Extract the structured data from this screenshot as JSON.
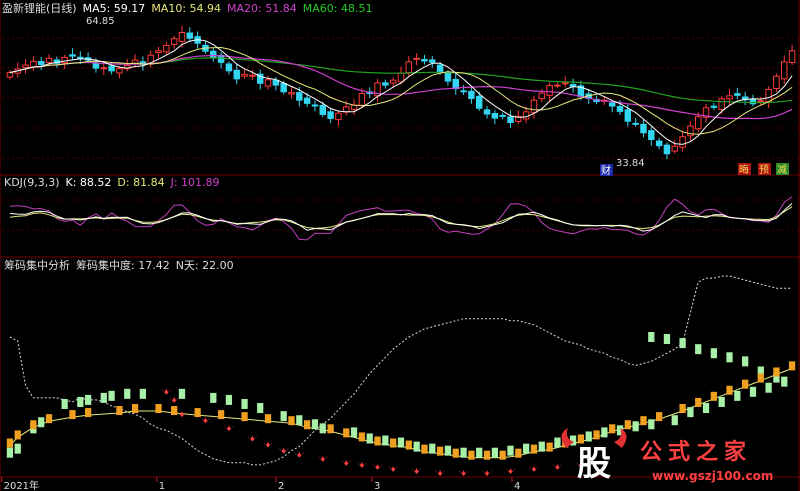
{
  "colors": {
    "bg": "#000000",
    "frame": "#6e0000",
    "grid": "#5a0000",
    "up": "#ff3a3a",
    "down": "#33d6f0",
    "ma5": "#ffffff",
    "ma10": "#e8e87a",
    "ma20": "#d040d0",
    "ma60": "#22a022",
    "k": "#ffffff",
    "d": "#e8e87a",
    "j": "#c040c0",
    "green_bar": "#a8f0a8",
    "orange_bar": "#f0a020",
    "red_mark": "#ff4040"
  },
  "price_panel": {
    "title": "盈新锂能(日线)",
    "ma5_label": "MA5: 59.17",
    "ma10_label": "MA10: 54.94",
    "ma20_label": "MA20: 51.84",
    "ma60_label": "MA60: 48.51",
    "high_label": "64.85",
    "low_label": "33.84",
    "flag_cai": "财",
    "flag_hui": "晦",
    "flag_yu": "预",
    "flag_jian": "减"
  },
  "kdj_panel": {
    "title": "KDJ(9,3,3)",
    "k_label": "K: 88.52",
    "d_label": "D: 81.84",
    "j_label": "J: 101.89"
  },
  "chip_panel": {
    "title": "筹码集中分析",
    "conc_label": "筹码集中度: 17.42",
    "n_label": "N天: 22.00"
  },
  "x_axis": {
    "ticks": [
      {
        "label": "2021年",
        "pos": 0.002
      },
      {
        "label": "1",
        "pos": 0.196
      },
      {
        "label": "2",
        "pos": 0.345
      },
      {
        "label": "3",
        "pos": 0.465
      },
      {
        "label": "4",
        "pos": 0.64
      }
    ]
  },
  "watermark": {
    "big_char": "股",
    "text": "公式之家",
    "url": "www.gszj100.com"
  },
  "chart_data": [
    {
      "type": "candlestick",
      "title": "盈新锂能(日线)",
      "n_days": 101,
      "ylim": [
        32,
        67
      ],
      "close": [
        54.3,
        55.1,
        56.0,
        56.8,
        56.1,
        57.5,
        56.4,
        57.7,
        58.0,
        57.4,
        57.1,
        55.3,
        55.4,
        54.7,
        55.2,
        55.9,
        57.1,
        56.1,
        58.2,
        59.2,
        60.4,
        61.9,
        63.3,
        62.0,
        60.9,
        59.1,
        57.7,
        56.6,
        54.7,
        52.9,
        53.9,
        53.7,
        51.9,
        52.7,
        51.5,
        50.0,
        49.8,
        48.1,
        47.4,
        46.8,
        44.9,
        44.0,
        45.2,
        46.6,
        47.0,
        49.6,
        49.6,
        52.0,
        51.5,
        52.6,
        54.2,
        56.7,
        57.5,
        56.9,
        56.6,
        54.4,
        52.4,
        50.7,
        50.1,
        48.5,
        46.3,
        45.0,
        44.1,
        44.6,
        43.1,
        44.5,
        45.5,
        48.1,
        49.7,
        51.4,
        51.5,
        52.0,
        51.2,
        48.9,
        48.5,
        47.8,
        48.1,
        46.8,
        45.6,
        43.4,
        42.7,
        40.8,
        39.3,
        37.9,
        36.1,
        37.8,
        39.9,
        42.3,
        44.4,
        46.4,
        46.5,
        48.4,
        49.1,
        49.2,
        48.2,
        47.3,
        48.0,
        50.5,
        53.5,
        56.7,
        59.2
      ],
      "ma5_last": 59.17,
      "ma10_last": 54.94,
      "ma20_last": 51.84,
      "ma60_last": 48.51,
      "high": 64.85,
      "low": 33.84
    },
    {
      "type": "line",
      "title": "KDJ(9,3,3)",
      "ylim": [
        -10,
        115
      ],
      "series": [
        {
          "name": "K",
          "values": [
            68.3,
            67.2,
            66.6,
            71.5,
            72.8,
            71.0,
            63.3,
            57.4,
            57.3,
            55.5,
            58.3,
            61.6,
            58.6,
            61.1,
            60.7,
            60.9,
            54.1,
            48.5,
            47.8,
            50.1,
            56.3,
            62.4,
            69.4,
            69.5,
            64.6,
            58.6,
            53.1,
            54.5,
            51.6,
            47.1,
            48.6,
            47.7,
            46.7,
            52.2,
            57.6,
            56.6,
            54.0,
            45.6,
            35.2,
            38.6,
            37.9,
            35.9,
            43.5,
            51.5,
            54.4,
            58.8,
            62.6,
            68.1,
            67.8,
            67.7,
            65.6,
            68.3,
            65.9,
            66.2,
            64.3,
            56.3,
            48.8,
            47.0,
            46.2,
            43.5,
            38.4,
            42.2,
            46.1,
            50.1,
            58.5,
            66.8,
            67.9,
            71.2,
            65.6,
            59.3,
            55.4,
            49.6,
            45.7,
            44.9,
            45.2,
            44.0,
            44.6,
            43.2,
            45.1,
            43.5,
            38.8,
            33.4,
            36.0,
            44.1,
            53.9,
            64.9,
            71.5,
            67.5,
            63.8,
            60.2,
            65.9,
            66.1,
            60.7,
            58.8,
            58.1,
            55.3,
            54.7,
            53.7,
            59.1,
            74.7,
            88.5
          ]
        },
        {
          "name": "D",
          "values": [
            61.1,
            62.9,
            63.8,
            68.5,
            69.6,
            65.8,
            60.5,
            57.0,
            57.9,
            57.6,
            58.7,
            59.6,
            58.0,
            58.4,
            59.4,
            59.0,
            54.6,
            51.3,
            50.8,
            52.4,
            56.2,
            61.8,
            66.9,
            66.2,
            62.6,
            58.3,
            55.3,
            53.9,
            51.1,
            48.5,
            49.1,
            50.6,
            51.4,
            53.4,
            56.1,
            55.6,
            51.4,
            45.6,
            40.5,
            38.9,
            39.9,
            41.4,
            45.9,
            51.3,
            55.3,
            58.6,
            63.3,
            65.8,
            66.4,
            66.1,
            66.4,
            65.2,
            65.2,
            64.6,
            61.7,
            57.5,
            51.6,
            47.2,
            45.1,
            43.2,
            42.3,
            44.5,
            48.4,
            54.1,
            60.7,
            64.9,
            66.5,
            66.0,
            62.5,
            58.5,
            53.9,
            49.8,
            46.0,
            44.0,
            43.8,
            44.0,
            44.8,
            44.7,
            44.2,
            41.5,
            39.6,
            38.6,
            40.3,
            45.4,
            53.8,
            61.1,
            63.2,
            62.6,
            61.6,
            63.3,
            64.0,
            63.1,
            61.3,
            58.9,
            58.0,
            57.2,
            56.8,
            56.3,
            61.9,
            72.1,
            81.8
          ]
        },
        {
          "name": "J",
          "values": [
            82.7,
            83.6,
            82.3,
            77.5,
            78.0,
            73.5,
            58.2,
            52.7,
            55.4,
            44.9,
            59.6,
            67.7,
            56.9,
            69.5,
            59.0,
            53.5,
            42.4,
            42.1,
            42.8,
            54.3,
            66.3,
            85.0,
            85.5,
            70.2,
            53.6,
            45.0,
            46.9,
            58.1,
            49.8,
            42.1,
            40.3,
            35.9,
            44.2,
            54.7,
            59.3,
            52.1,
            39.2,
            16.9,
            16.0,
            29.2,
            28.9,
            29.1,
            47.2,
            64.6,
            70.1,
            74.6,
            77.1,
            79.9,
            72.8,
            73.4,
            74.7,
            74.7,
            68.5,
            65.6,
            57.3,
            37.5,
            31.3,
            33.0,
            30.3,
            27.2,
            28.1,
            37.3,
            48.4,
            66.0,
            87.5,
            87.6,
            82.7,
            69.6,
            50.4,
            39.1,
            34.1,
            30.8,
            28.1,
            33.4,
            38.3,
            37.0,
            40.5,
            36.3,
            36.7,
            34.9,
            27.7,
            25.7,
            35.5,
            54.7,
            81.3,
            96.8,
            86.6,
            72.0,
            65.6,
            75.8,
            76.7,
            68.7,
            59.8,
            59.0,
            57.4,
            54.2,
            53.6,
            50.5,
            65.4,
            90.4,
            101.9
          ]
        }
      ],
      "last": {
        "K": 88.52,
        "D": 81.84,
        "J": 101.89
      }
    },
    {
      "type": "bar",
      "title": "筹码集中分析",
      "ylim": [
        0,
        100
      ],
      "upper_line": [
        68,
        66,
        44,
        38,
        38,
        38,
        38,
        37,
        36,
        38,
        37,
        37,
        36,
        34,
        33,
        31,
        30,
        28,
        25,
        23,
        22,
        20,
        18,
        15,
        12,
        10,
        8,
        7,
        6,
        6,
        6,
        5,
        5,
        6,
        7,
        9,
        12,
        14,
        18,
        22,
        25,
        28,
        32,
        36,
        40,
        45,
        50,
        54,
        58,
        62,
        65,
        68,
        70,
        72,
        73,
        74,
        75,
        76,
        77,
        77,
        77,
        77,
        77,
        77,
        76,
        76,
        75,
        74,
        72,
        70,
        68,
        66,
        65,
        64,
        62,
        61,
        60,
        58,
        57,
        55,
        54,
        55,
        56,
        58,
        60,
        62,
        65,
        80,
        95,
        97,
        97,
        98,
        98,
        97,
        96,
        95,
        94,
        93,
        92,
        92,
        92
      ],
      "green_bars": [
        [
          0,
          10
        ],
        [
          1,
          12
        ],
        [
          3,
          22
        ],
        [
          4,
          25
        ],
        [
          7,
          34
        ],
        [
          9,
          35
        ],
        [
          10,
          36
        ],
        [
          12,
          37
        ],
        [
          13,
          38
        ],
        [
          15,
          39
        ],
        [
          17,
          39
        ],
        [
          22,
          39
        ],
        [
          26,
          37
        ],
        [
          28,
          36
        ],
        [
          30,
          34
        ],
        [
          32,
          32
        ],
        [
          35,
          28
        ],
        [
          37,
          26
        ],
        [
          39,
          24
        ],
        [
          40,
          22
        ],
        [
          44,
          20
        ],
        [
          46,
          17
        ],
        [
          48,
          16
        ],
        [
          50,
          15
        ],
        [
          52,
          13
        ],
        [
          54,
          12
        ],
        [
          56,
          11
        ],
        [
          58,
          10
        ],
        [
          60,
          10
        ],
        [
          62,
          10
        ],
        [
          64,
          11
        ],
        [
          66,
          12
        ],
        [
          68,
          13
        ],
        [
          70,
          15
        ],
        [
          72,
          16
        ],
        [
          74,
          18
        ],
        [
          76,
          20
        ],
        [
          78,
          21
        ],
        [
          80,
          23
        ],
        [
          82,
          24
        ],
        [
          85,
          26
        ],
        [
          87,
          30
        ],
        [
          89,
          32
        ],
        [
          91,
          35
        ],
        [
          93,
          38
        ],
        [
          95,
          40
        ],
        [
          97,
          42
        ],
        [
          99,
          45
        ],
        [
          98,
          47
        ],
        [
          96,
          50
        ],
        [
          94,
          55
        ],
        [
          92,
          57
        ],
        [
          90,
          59
        ],
        [
          88,
          61
        ],
        [
          86,
          64
        ],
        [
          84,
          66
        ],
        [
          82,
          67
        ]
      ],
      "orange_bars": [
        [
          0,
          16
        ],
        [
          1,
          20
        ],
        [
          3,
          25
        ],
        [
          5,
          28
        ],
        [
          8,
          30
        ],
        [
          10,
          31
        ],
        [
          14,
          32
        ],
        [
          16,
          33
        ],
        [
          19,
          33
        ],
        [
          21,
          32
        ],
        [
          24,
          31
        ],
        [
          27,
          30
        ],
        [
          30,
          29
        ],
        [
          33,
          28
        ],
        [
          36,
          27
        ],
        [
          38,
          25
        ],
        [
          41,
          23
        ],
        [
          43,
          21
        ],
        [
          45,
          19
        ],
        [
          47,
          17
        ],
        [
          49,
          16
        ],
        [
          51,
          15
        ],
        [
          53,
          13
        ],
        [
          55,
          12
        ],
        [
          57,
          11
        ],
        [
          59,
          10
        ],
        [
          61,
          10
        ],
        [
          63,
          10
        ],
        [
          65,
          11
        ],
        [
          67,
          13
        ],
        [
          69,
          14
        ],
        [
          71,
          16
        ],
        [
          73,
          18
        ],
        [
          75,
          20
        ],
        [
          77,
          23
        ],
        [
          79,
          25
        ],
        [
          81,
          27
        ],
        [
          83,
          29
        ],
        [
          86,
          33
        ],
        [
          88,
          36
        ],
        [
          90,
          39
        ],
        [
          92,
          42
        ],
        [
          94,
          45
        ],
        [
          96,
          48
        ],
        [
          98,
          51
        ],
        [
          100,
          54
        ]
      ],
      "red_marks": [
        [
          20,
          41
        ],
        [
          21,
          37
        ],
        [
          22,
          30
        ],
        [
          25,
          27
        ],
        [
          28,
          23
        ],
        [
          31,
          18
        ],
        [
          33,
          15
        ],
        [
          35,
          12
        ],
        [
          37,
          10
        ],
        [
          40,
          8
        ],
        [
          43,
          6
        ],
        [
          45,
          5
        ],
        [
          47,
          4
        ],
        [
          49,
          3
        ],
        [
          52,
          2
        ],
        [
          55,
          1
        ],
        [
          58,
          1
        ],
        [
          61,
          1
        ],
        [
          64,
          2
        ],
        [
          67,
          3
        ],
        [
          70,
          4
        ],
        [
          73,
          5
        ],
        [
          76,
          6
        ]
      ],
      "conc_last": 17.42,
      "n_days": 22.0
    }
  ]
}
